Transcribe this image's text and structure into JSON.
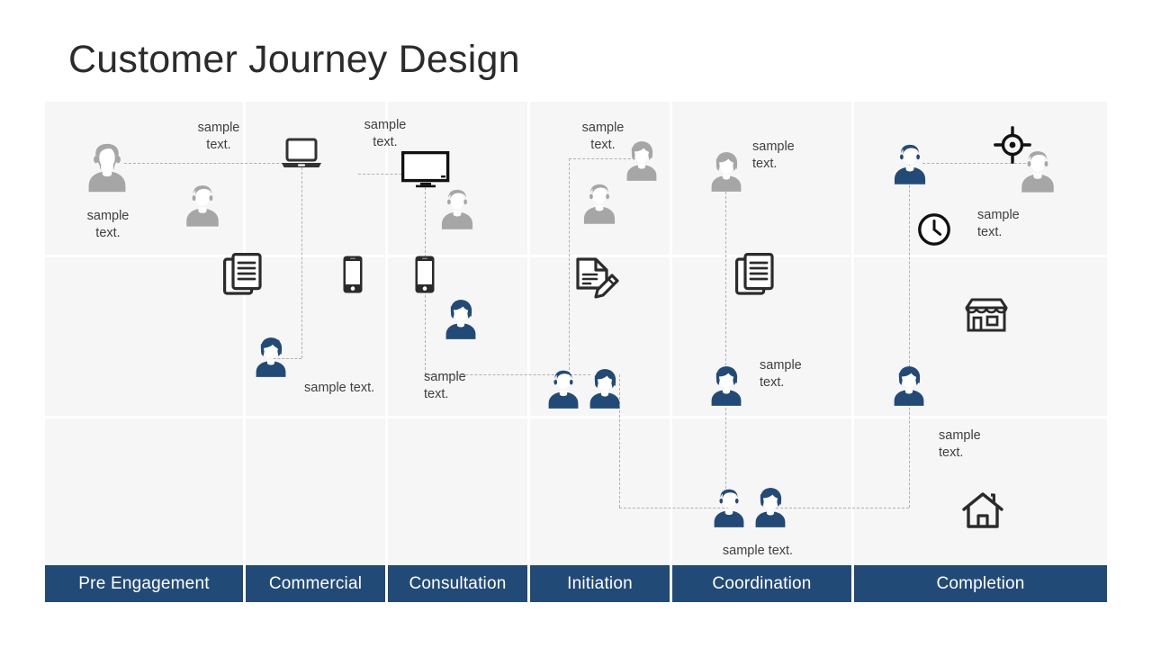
{
  "title": "Customer Journey Design",
  "colors": {
    "navy": "#224a77",
    "grey_person": "#a6a6a6",
    "dark_icon": "#2b2b2b",
    "band": "#f6f6f6",
    "text": "#404040"
  },
  "stages": [
    {
      "label": "Pre Engagement"
    },
    {
      "label": "Commercial"
    },
    {
      "label": "Consultation"
    },
    {
      "label": "Initiation"
    },
    {
      "label": "Coordination"
    },
    {
      "label": "Completion"
    }
  ],
  "annotations": [
    {
      "id": "a1",
      "text": "sample\ntext."
    },
    {
      "id": "a2",
      "text": "sample\ntext."
    },
    {
      "id": "a3",
      "text": "sample\ntext."
    },
    {
      "id": "a4",
      "text": "sample\ntext."
    },
    {
      "id": "a5",
      "text": "sample\ntext."
    },
    {
      "id": "a6",
      "text": "sample\ntext."
    },
    {
      "id": "a7",
      "text": "sample text."
    },
    {
      "id": "a8",
      "text": "sample\ntext."
    },
    {
      "id": "a9",
      "text": "sample\ntext."
    },
    {
      "id": "a10",
      "text": "sample\ntext."
    },
    {
      "id": "a11",
      "text": "sample\ntext."
    },
    {
      "id": "a12",
      "text": "sample text."
    }
  ],
  "icons": [
    {
      "id": "i1",
      "name": "person-grey-male"
    },
    {
      "id": "i2",
      "name": "person-grey-male"
    },
    {
      "id": "i3",
      "name": "documents-stack"
    },
    {
      "id": "i4",
      "name": "laptop"
    },
    {
      "id": "i5",
      "name": "smartphone"
    },
    {
      "id": "i6",
      "name": "person-blue-female"
    },
    {
      "id": "i7",
      "name": "monitor"
    },
    {
      "id": "i8",
      "name": "person-grey-male"
    },
    {
      "id": "i9",
      "name": "smartphone"
    },
    {
      "id": "i10",
      "name": "person-blue-female"
    },
    {
      "id": "i11",
      "name": "person-grey-female"
    },
    {
      "id": "i12",
      "name": "person-grey-male"
    },
    {
      "id": "i13",
      "name": "document-edit"
    },
    {
      "id": "i14",
      "name": "person-blue-male"
    },
    {
      "id": "i15",
      "name": "person-blue-female"
    },
    {
      "id": "i16",
      "name": "person-grey-female"
    },
    {
      "id": "i17",
      "name": "documents-stack"
    },
    {
      "id": "i18",
      "name": "person-blue-female"
    },
    {
      "id": "i19",
      "name": "person-blue-male"
    },
    {
      "id": "i20",
      "name": "person-blue-female"
    },
    {
      "id": "i21",
      "name": "person-blue-male"
    },
    {
      "id": "i22",
      "name": "target-crosshair"
    },
    {
      "id": "i23",
      "name": "person-grey-male"
    },
    {
      "id": "i24",
      "name": "clock"
    },
    {
      "id": "i25",
      "name": "storefront"
    },
    {
      "id": "i26",
      "name": "person-blue-female"
    },
    {
      "id": "i27",
      "name": "house"
    }
  ]
}
